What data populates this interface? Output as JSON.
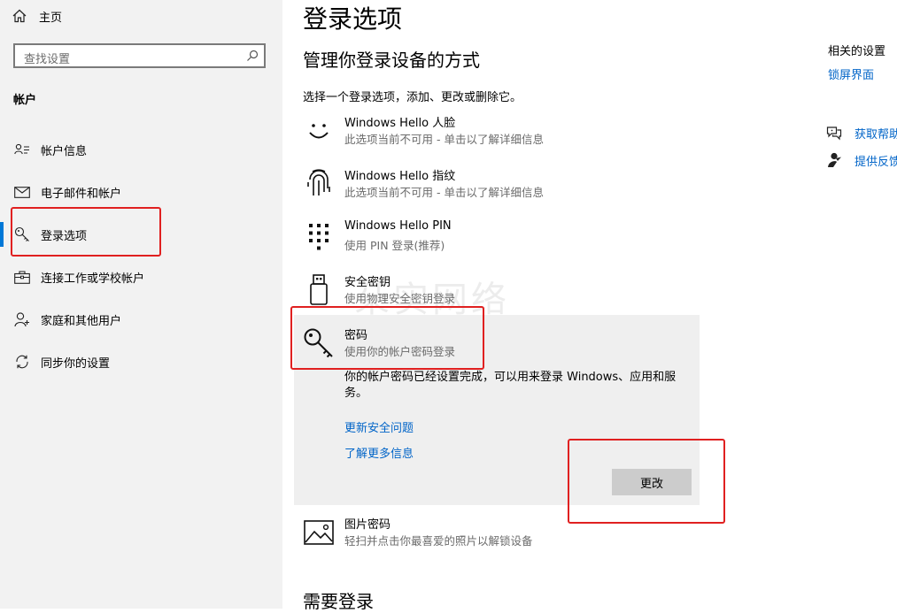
{
  "sidebar": {
    "home_label": "主页",
    "search_placeholder": "查找设置",
    "section_header": "帐户",
    "items": [
      {
        "label": "帐户信息",
        "icon": "account-info-icon"
      },
      {
        "label": "电子邮件和帐户",
        "icon": "mail-icon"
      },
      {
        "label": "登录选项",
        "icon": "key-icon",
        "selected": true
      },
      {
        "label": "连接工作或学校帐户",
        "icon": "briefcase-icon"
      },
      {
        "label": "家庭和其他用户",
        "icon": "add-user-icon"
      },
      {
        "label": "同步你的设置",
        "icon": "sync-icon"
      }
    ]
  },
  "main": {
    "title": "登录选项",
    "subtitle": "管理你登录设备的方式",
    "description": "选择一个登录选项，添加、更改或删除它。",
    "options": [
      {
        "title": "Windows Hello 人脸",
        "subtitle": "此选项当前不可用 - 单击以了解详细信息",
        "icon": "face-icon"
      },
      {
        "title": "Windows Hello 指纹",
        "subtitle": "此选项当前不可用 - 单击以了解详细信息",
        "icon": "fingerprint-icon"
      },
      {
        "title": "Windows Hello PIN",
        "subtitle": "使用 PIN 登录(推荐)",
        "icon": "pin-keypad-icon"
      },
      {
        "title": "安全密钥",
        "subtitle": "使用物理安全密钥登录",
        "icon": "usb-key-icon"
      }
    ],
    "password": {
      "title": "密码",
      "subtitle": "使用你的帐户密码登录",
      "detail": "你的帐户密码已经设置完成，可以用来登录 Windows、应用和服务。",
      "link_security_questions": "更新安全问题",
      "link_learn_more": "了解更多信息",
      "change_button": "更改"
    },
    "picture_password": {
      "title": "图片密码",
      "subtitle": "轻扫并点击你最喜爱的照片以解锁设备",
      "icon": "picture-icon"
    },
    "bottom_heading": "需要登录",
    "watermark": "朵实网络"
  },
  "related": {
    "heading": "相关的设置",
    "lock_screen_link": "锁屏界面",
    "get_help": "获取帮助",
    "give_feedback": "提供反馈"
  },
  "colors": {
    "accent": "#0078d7",
    "link": "#0064c8",
    "highlight_box": "#e02020"
  }
}
